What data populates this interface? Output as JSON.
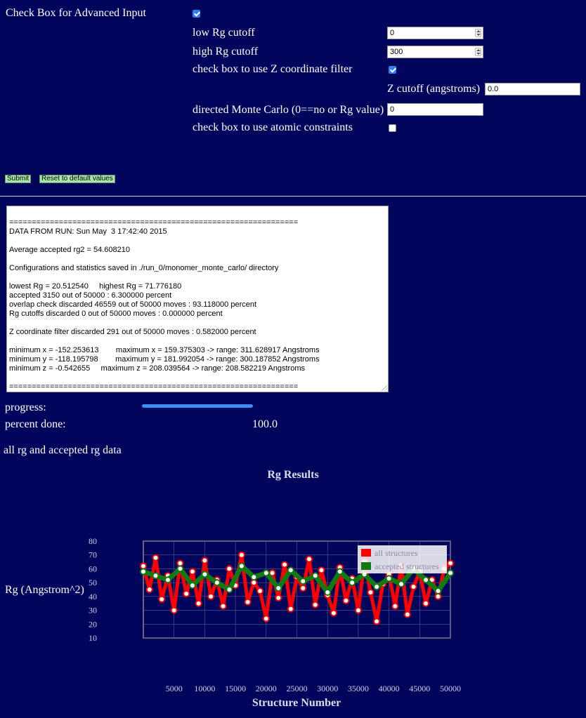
{
  "form": {
    "advanced_label": "Check Box for Advanced Input",
    "advanced_checked": true,
    "low_rg_label": "low Rg cutoff",
    "low_rg_value": "0",
    "high_rg_label": "high Rg cutoff",
    "high_rg_value": "300",
    "zfilter_label": "check box to use Z coordinate filter",
    "zfilter_checked": true,
    "zcutoff_label": "Z cutoff (angstroms)",
    "zcutoff_value": "0.0",
    "directed_label": "directed Monte Carlo (0==no or Rg value)",
    "directed_value": "0",
    "atomic_label": "check box to use atomic constraints",
    "atomic_checked": false
  },
  "buttons": {
    "submit": "Submit",
    "reset": "Reset to default values"
  },
  "console_lines": [
    "",
    "================================================================",
    "DATA FROM RUN: Sun May  3 17:42:40 2015",
    "",
    "Average accepted rg2 = 54.608210",
    "",
    "Configurations and statistics saved in ./run_0/monomer_monte_carlo/ directory",
    "",
    "lowest Rg = 20.512540     highest Rg = 71.776180",
    "accepted 3150 out of 50000 : 6.300000 percent",
    "overlap check discarded 46559 out of 50000 moves : 93.118000 percent",
    "Rg cutoffs discarded 0 out of 50000 moves : 0.000000 percent",
    "",
    "Z coordinate filter discarded 291 out of 50000 moves : 0.582000 percent",
    "",
    "minimum x = -152.253613        maximum x = 159.375303 -> range: 311.628917 Angstroms",
    "minimum y = -118.195798        maximum y = 181.992054 -> range: 300.187852 Angstroms",
    "minimum z = -0.542655     maximum z = 208.039564 -> range: 208.582219 Angstroms",
    "",
    "================================================================"
  ],
  "progress": {
    "label": "progress:",
    "fraction": 1.0,
    "percent_label": "percent done:",
    "percent_value": "100.0"
  },
  "section_title": "all rg and accepted rg data",
  "colors": {
    "background": "#01055b",
    "all_structures": "#ff0000",
    "accepted_structures": "#117a11",
    "progress": "#3d8df5"
  },
  "chart_data": {
    "type": "scatter",
    "title": "Rg Results",
    "xlabel": "Structure Number",
    "ylabel": "Rg (Angstrom^2)",
    "xlim": [
      0,
      50000
    ],
    "ylim": [
      10,
      80
    ],
    "x_ticks": [
      5000,
      10000,
      15000,
      20000,
      25000,
      30000,
      35000,
      40000,
      45000,
      50000
    ],
    "y_ticks": [
      10,
      20,
      30,
      40,
      50,
      60,
      70,
      80
    ],
    "grid": true,
    "legend_position": "top-right",
    "series": [
      {
        "name": "all structures",
        "x": [
          0,
          1000,
          2000,
          3000,
          4000,
          5000,
          6000,
          7000,
          8000,
          9000,
          10000,
          11000,
          12000,
          13000,
          14000,
          15000,
          16000,
          17000,
          18000,
          19000,
          20000,
          21000,
          22000,
          23000,
          24000,
          25000,
          26000,
          27000,
          28000,
          29000,
          30000,
          31000,
          32000,
          33000,
          34000,
          35000,
          36000,
          37000,
          38000,
          39000,
          40000,
          41000,
          42000,
          43000,
          44000,
          45000,
          46000,
          47000,
          48000,
          49000,
          50000
        ],
        "y": [
          62,
          45,
          68,
          38,
          55,
          30,
          64,
          42,
          58,
          35,
          66,
          40,
          52,
          33,
          60,
          48,
          70,
          36,
          50,
          44,
          24,
          57,
          39,
          63,
          31,
          54,
          46,
          67,
          34,
          59,
          41,
          28,
          61,
          37,
          53,
          30,
          65,
          43,
          22,
          49,
          56,
          33,
          62,
          27,
          47,
          58,
          35,
          52,
          40,
          60,
          64
        ]
      },
      {
        "name": "accepted structures",
        "x": [
          0,
          2000,
          4000,
          6000,
          8000,
          10000,
          12000,
          14000,
          16000,
          18000,
          20000,
          22000,
          24000,
          26000,
          28000,
          30000,
          32000,
          34000,
          36000,
          38000,
          40000,
          42000,
          44000,
          46000,
          48000,
          50000
        ],
        "y": [
          58,
          55,
          52,
          60,
          48,
          56,
          50,
          45,
          62,
          54,
          57,
          46,
          59,
          51,
          55,
          43,
          58,
          50,
          56,
          47,
          53,
          49,
          60,
          52,
          44,
          57
        ]
      }
    ]
  }
}
